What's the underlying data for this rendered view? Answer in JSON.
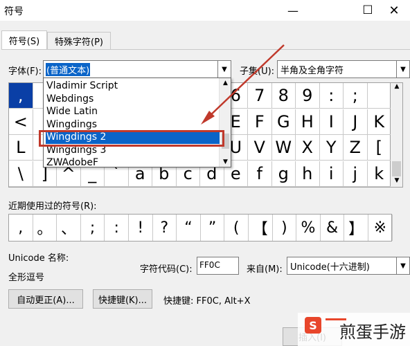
{
  "window": {
    "title": "符号",
    "minimize": "—",
    "maximize": "☐",
    "close": "✕"
  },
  "tabs": [
    {
      "label": "符号(S)"
    },
    {
      "label": "特殊字符(P)"
    }
  ],
  "font": {
    "label": "字体(F):",
    "value": "(普通文本)"
  },
  "subset": {
    "label": "子集(U):",
    "value": "半角及全角字符"
  },
  "font_dropdown": {
    "items": [
      "Vladimir Script",
      "Webdings",
      "Wide Latin",
      "Wingdings",
      "Wingdings 2",
      "Wingdings 3",
      "ZWAdobeF"
    ],
    "highlighted_index": 4
  },
  "grid": {
    "rows": [
      [
        ",",
        "",
        "",
        "",
        "",
        "",
        "",
        "",
        "",
        "6",
        "7",
        "8",
        "9",
        ":",
        ";",
        ""
      ],
      [
        "<",
        "",
        "",
        "",
        "",
        "",
        "",
        "",
        "",
        "E",
        "F",
        "G",
        "H",
        "I",
        "J",
        "K"
      ],
      [
        "L",
        "",
        "",
        "",
        "",
        "",
        "",
        "",
        "",
        "U",
        "V",
        "W",
        "X",
        "Y",
        "Z",
        "["
      ],
      [
        "\\",
        "]",
        "^",
        "_",
        "`",
        "a",
        "b",
        "c",
        "d",
        "e",
        "f",
        "g",
        "h",
        "i",
        "j",
        "k"
      ]
    ]
  },
  "recent": {
    "label": "近期使用过的符号(R):",
    "symbols": [
      ",",
      "。",
      "、",
      ";",
      ":",
      "!",
      "?",
      "“",
      "”",
      "(",
      "【",
      ")",
      "%",
      "&",
      "】",
      "※"
    ]
  },
  "unicode": {
    "name_label": "Unicode 名称:",
    "name_value": "全形逗号"
  },
  "charcode": {
    "label": "字符代码(C):",
    "value": "FF0C"
  },
  "from": {
    "label": "来自(M):",
    "value": "Unicode(十六进制)"
  },
  "buttons": {
    "autocorrect": "自动更正(A)...",
    "shortcut": "快捷键(K)...",
    "insert": "插入(I)"
  },
  "shortcut_text": "快捷键: FF0C, Alt+X",
  "watermark": {
    "text": "煎蛋手游",
    "brand_color": "#e8462b"
  }
}
